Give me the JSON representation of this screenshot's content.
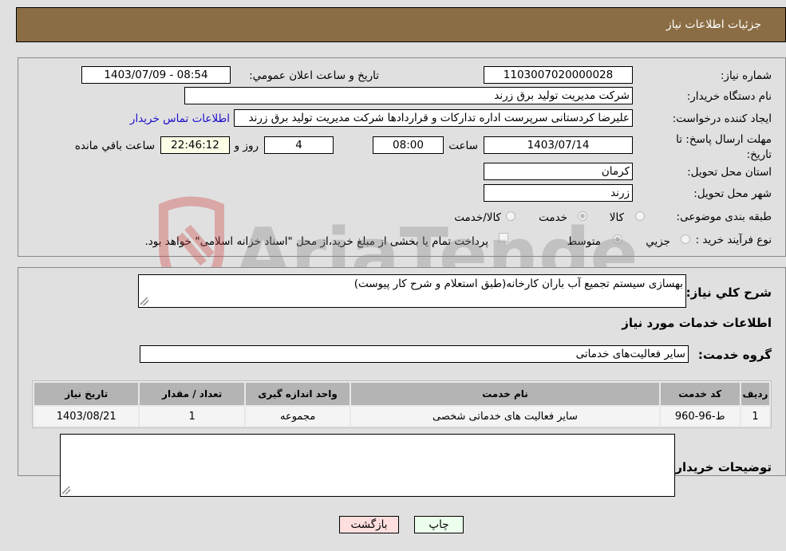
{
  "header": {
    "title": "جزئیات اطلاعات نیاز"
  },
  "form": {
    "need_number_label": "شماره نیاز:",
    "need_number": "1103007020000028",
    "announce_label": "تاریخ و ساعت اعلان عمومي:",
    "announce_value": "1403/07/09 - 08:54",
    "buyer_org_label": "نام دستگاه خریدار:",
    "buyer_org": "شرکت مدیریت تولید برق زرند",
    "requester_label": "ایجاد کننده درخواست:",
    "requester": "علیرضا کردستانی سرپرست اداره تدارکات و قراردادها شرکت مدیریت تولید برق زرند",
    "contact_link": "اطلاعات تماس خریدار",
    "deadline_label": "مهلت ارسال پاسخ: تا تاریخ:",
    "deadline_date": "1403/07/14",
    "time_label": "ساعت",
    "deadline_time": "08:00",
    "days_value": "4",
    "days_label": "روز و",
    "remaining_time": "22:46:12",
    "remaining_label": "ساعت باقي مانده",
    "province_label": "استان محل تحویل:",
    "province": "کرمان",
    "city_label": "شهر محل تحویل:",
    "city": "زرند",
    "category_label": "طبقه بندی موضوعی:",
    "category_options": [
      {
        "label": "کالا",
        "selected": false
      },
      {
        "label": "خدمت",
        "selected": true
      },
      {
        "label": "کالا/خدمت",
        "selected": false
      }
    ],
    "process_label": "نوع فرآیند خرید :",
    "process_options": [
      {
        "label": "جزيي",
        "selected": false
      },
      {
        "label": "متوسط",
        "selected": true
      }
    ],
    "treasury_checkbox_label": "پرداخت تمام یا بخشی از مبلغ خرید،از محل \"اسناد خزانه اسلامی\" خواهد بود.",
    "treasury_checked": false
  },
  "details": {
    "description_label": "شرح کلي نياز:",
    "description": "بهسازی سیستم تجمیع آب باران کارخانه(طبق استعلام و شرح کار پیوست)",
    "services_heading": "اطلاعات خدمات مورد نیاز",
    "service_group_label": "گروه خدمت:",
    "service_group": "سایر فعالیت‌های خدماتی",
    "table": {
      "columns": [
        "ردیف",
        "کد خدمت",
        "نام خدمت",
        "واحد اندازه گیری",
        "تعداد / مقدار",
        "تاریخ نیاز"
      ],
      "rows": [
        [
          "1",
          "ط-96-960",
          "سایر فعالیت های خدماتی شخصی",
          "مجموعه",
          "1",
          "1403/08/21"
        ]
      ]
    },
    "buyer_notes_label": "توضیحات خریدار:",
    "buyer_notes": ""
  },
  "buttons": {
    "print": "چاپ",
    "back": "بازگشت"
  },
  "watermark": {
    "text": "AriaTender.neT"
  }
}
